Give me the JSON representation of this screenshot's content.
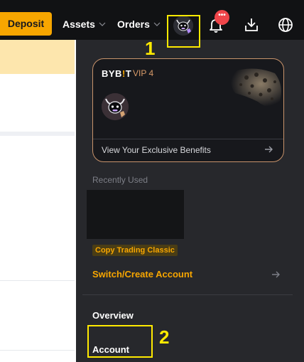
{
  "nav": {
    "deposit_label": "Deposit",
    "assets_label": "Assets",
    "orders_label": "Orders",
    "notification_badge": "•••"
  },
  "vip_card": {
    "brand_prefix": "BYB",
    "brand_mark": "!",
    "brand_suffix": "T",
    "level": "VIP 4",
    "benefits_link": "View Your Exclusive Benefits"
  },
  "recent": {
    "title": "Recently Used",
    "tag": "Copy Trading Classic"
  },
  "menu": {
    "switch_account": "Switch/Create Account",
    "overview": "Overview",
    "account": "Account"
  },
  "annotations": {
    "label_1": "1",
    "label_2": "2",
    "color": "#ffea00"
  },
  "colors": {
    "accent": "#f7a600",
    "panel_bg": "#27282c",
    "topbar_bg": "#111214",
    "vip_border": "#c8936b"
  }
}
